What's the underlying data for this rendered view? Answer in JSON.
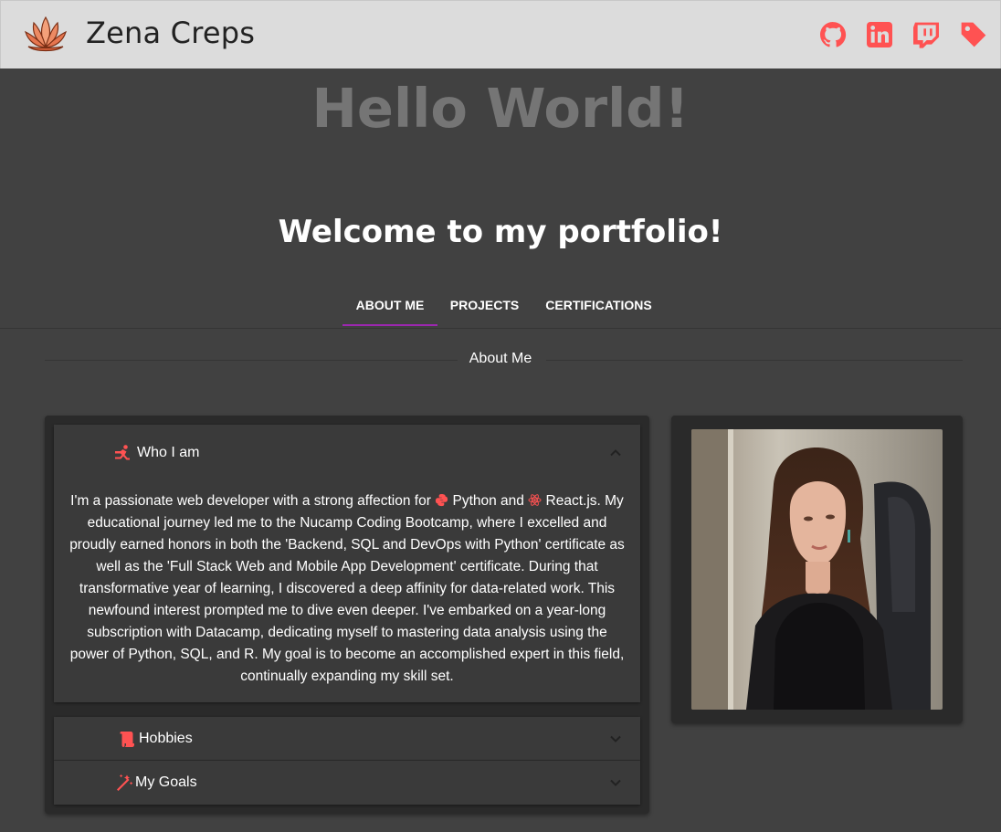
{
  "header": {
    "brand_name": "Zena Creps",
    "social_icons": [
      "github-icon",
      "linkedin-icon",
      "twitch-icon",
      "tag-icon"
    ],
    "icon_color": "#ff5252"
  },
  "hero": {
    "title": "Hello World!",
    "welcome": "Welcome to my portfolio!"
  },
  "tabs": [
    {
      "label": "About Me",
      "active": true
    },
    {
      "label": "Projects",
      "active": false
    },
    {
      "label": "Certifications",
      "active": false
    }
  ],
  "section": {
    "title": "About Me"
  },
  "accordions": [
    {
      "title": "Who I am",
      "icon": "person-running-icon",
      "expanded": true,
      "body": {
        "part1": "I'm a passionate web developer with a strong affection for ",
        "python_icon": "python-icon",
        "part2": " Python and ",
        "react_icon": "react-icon",
        "part3": " React.js. My educational journey led me to the Nucamp Coding Bootcamp, where I excelled and proudly earned honors in both the 'Backend, SQL and DevOps with Python' certificate as well as the 'Full Stack Web and Mobile App Development' certificate. During that transformative year of learning, I discovered a deep affinity for data-related work. This newfound interest prompted me to dive even deeper. I've embarked on a year-long subscription with Datacamp, dedicating myself to mastering data analysis using the power of Python, SQL, and R. My goal is to become an accomplished expert in this field, continually expanding my skill set."
      }
    },
    {
      "title": "Hobbies",
      "icon": "scroll-icon",
      "expanded": false
    },
    {
      "title": "My Goals",
      "icon": "magic-wand-icon",
      "expanded": false
    }
  ],
  "profile": {
    "photo_icon": "profile-photo"
  },
  "colors": {
    "accent": "#ff5252",
    "tab_indicator": "#9c27b0",
    "background": "#414141",
    "appbar": "#dcdcdc"
  }
}
